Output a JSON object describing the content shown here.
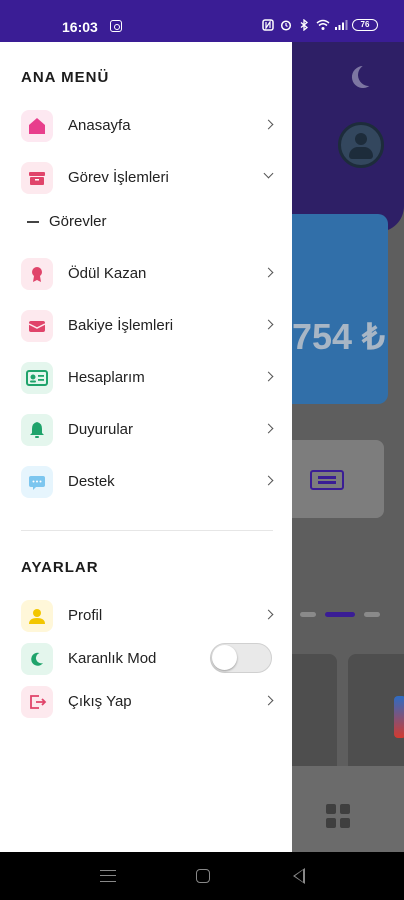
{
  "status_bar": {
    "time": "16:03",
    "icons": [
      "instagram-icon",
      "nfc-icon",
      "alarm-icon",
      "bluetooth-icon",
      "wifi-icon",
      "signal-icon"
    ],
    "battery": "76"
  },
  "background_app": {
    "balance": "754 ₺",
    "icons": [
      "moon-icon",
      "avatar-icon",
      "ticket-icon",
      "grid-icon"
    ]
  },
  "drawer": {
    "main_menu_title": "ANA MENÜ",
    "main_items": [
      {
        "label": "Anasayfa",
        "icon": "home-icon",
        "accent": "#e83e8c",
        "bg": "#fde8f1"
      },
      {
        "label": "Görev İşlemleri",
        "icon": "archive-icon",
        "accent": "#e0446a",
        "bg": "#fde9ee",
        "expanded": true
      },
      {
        "label": "Ödül Kazan",
        "icon": "award-icon",
        "accent": "#e0446a",
        "bg": "#fde9ee"
      },
      {
        "label": "Bakiye İşlemleri",
        "icon": "wallet-icon",
        "accent": "#e0446a",
        "bg": "#fde9ee"
      },
      {
        "label": "Hesaplarım",
        "icon": "id-card-icon",
        "accent": "#1fa36b",
        "bg": "#e4f6ed"
      },
      {
        "label": "Duyurular",
        "icon": "bell-icon",
        "accent": "#1fa36b",
        "bg": "#e4f6ed"
      },
      {
        "label": "Destek",
        "icon": "chat-icon",
        "accent": "#7cc6ef",
        "bg": "#e6f5fd"
      }
    ],
    "sub_items": [
      {
        "label": "Görevler"
      }
    ],
    "settings_title": "AYARLAR",
    "settings_items": [
      {
        "label": "Profil",
        "icon": "user-icon",
        "accent": "#f2c600",
        "bg": "#fff7d9"
      },
      {
        "label": "Karanlık Mod",
        "icon": "moon-icon",
        "accent": "#1fa36b",
        "bg": "#e4f6ed",
        "toggle_on": false
      },
      {
        "label": "Çıkış Yap",
        "icon": "logout-icon",
        "accent": "#e0446a",
        "bg": "#fde9ee"
      }
    ]
  },
  "nav_bar": {
    "icons": [
      "recent-apps-icon",
      "home-nav-icon",
      "back-icon"
    ]
  }
}
